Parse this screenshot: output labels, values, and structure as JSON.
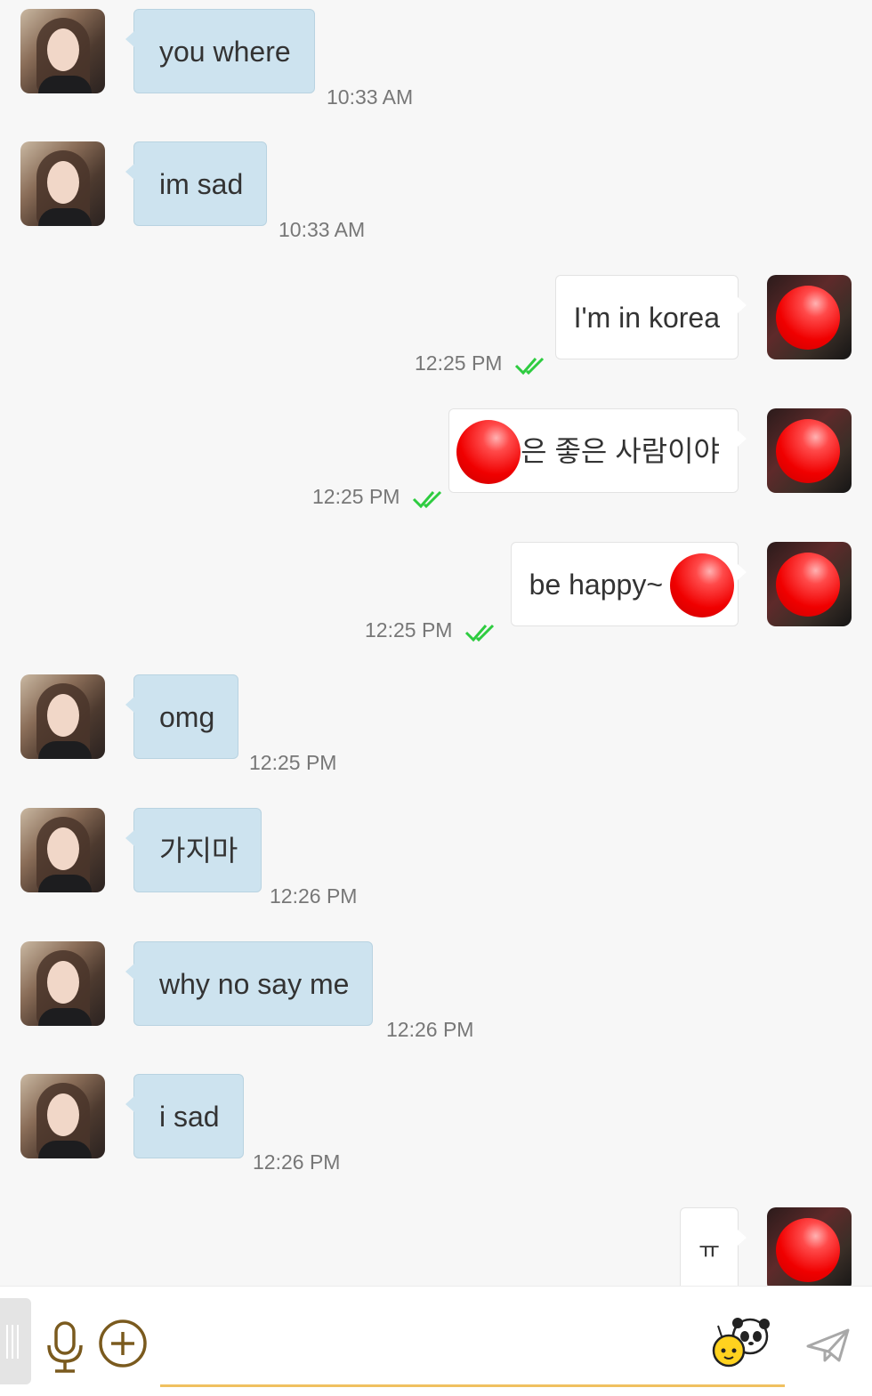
{
  "messages": [
    {
      "side": "in",
      "text": "you where",
      "time": "10:33 AM"
    },
    {
      "side": "in",
      "text": "im sad",
      "time": "10:33 AM"
    },
    {
      "side": "out",
      "text": "I'm in korea",
      "time": "12:25 PM",
      "read": true
    },
    {
      "side": "out",
      "text": "은 좋은 사람이야",
      "time": "12:25 PM",
      "read": true,
      "prefix_icon": "red-ball-sticker"
    },
    {
      "side": "out",
      "text": "be happy~",
      "time": "12:25 PM",
      "read": true,
      "suffix_icon": "red-ball-sticker"
    },
    {
      "side": "in",
      "text": "omg",
      "time": "12:25 PM"
    },
    {
      "side": "in",
      "text": "가지마",
      "time": "12:26 PM"
    },
    {
      "side": "in",
      "text": "why no say me",
      "time": "12:26 PM"
    },
    {
      "side": "in",
      "text": "i sad",
      "time": "12:26 PM"
    },
    {
      "side": "out",
      "text": "ㅠ",
      "time": "",
      "read": false
    }
  ],
  "colors": {
    "incoming_bubble": "#cde3ef",
    "outgoing_bubble": "#ffffff",
    "read_check": "#2ecc40",
    "input_underline": "#f0c060",
    "icon_brown": "#7a5a1e"
  },
  "input_bar": {
    "icons": [
      "drawer-handle-icon",
      "microphone-icon",
      "add-circle-icon",
      "emoji-sticker-icon",
      "send-icon"
    ],
    "text_value": ""
  }
}
